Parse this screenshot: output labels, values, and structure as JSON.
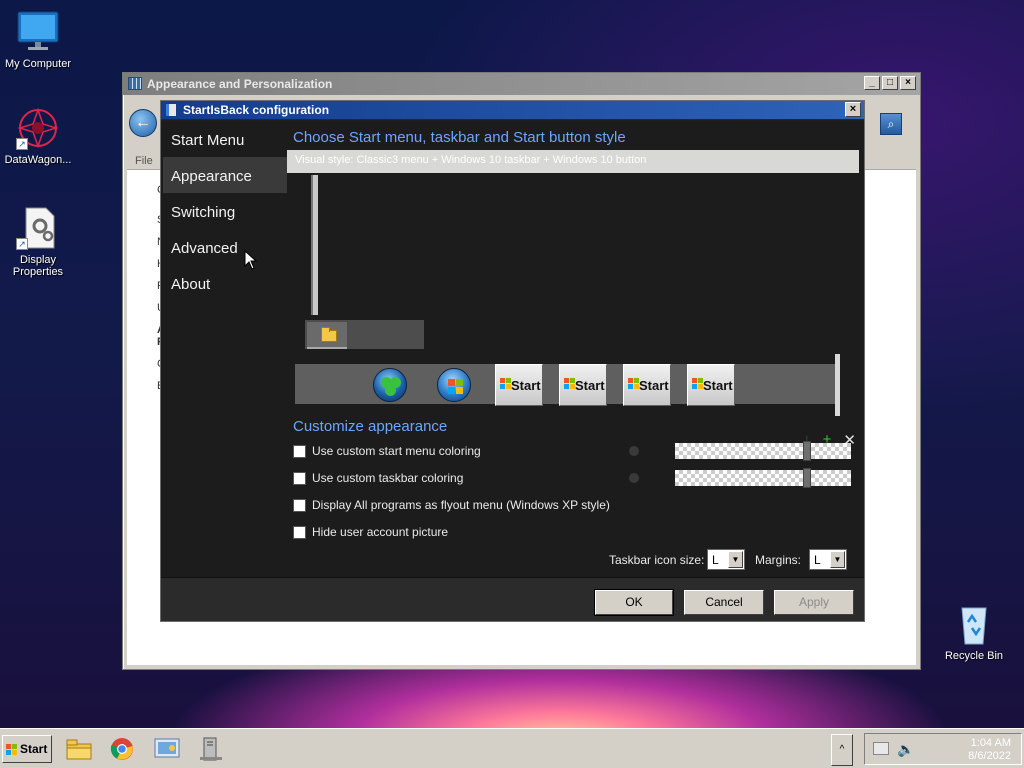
{
  "desktop": {
    "icons": [
      {
        "label": "My Computer",
        "icon": "monitor-icon"
      },
      {
        "label": "DataWagon...",
        "icon": "datawagon-icon"
      },
      {
        "label": "Display Properties",
        "icon": "display-properties-icon"
      },
      {
        "label": "Recycle Bin",
        "icon": "recycle-bin-icon"
      }
    ]
  },
  "outer_window": {
    "title": "Appearance and Personalization",
    "menu_file": "File",
    "list_letters": [
      "C",
      "S",
      "N",
      "H",
      "P",
      "U",
      "A",
      "P",
      "C",
      "E"
    ]
  },
  "dialog": {
    "title": "StartIsBack configuration",
    "nav": [
      "Start Menu",
      "Appearance",
      "Switching",
      "Advanced",
      "About"
    ],
    "active_nav": "Appearance",
    "heading_style": "Choose Start menu, taskbar and Start button style",
    "visual_style": "Visual style:  Classic3 menu + Windows 10 taskbar + Windows 10 button",
    "start_samples": [
      "Start",
      "Start",
      "Start",
      "Start"
    ],
    "heading_customize": "Customize appearance",
    "options": [
      {
        "label": "Use custom start menu coloring",
        "checked": false
      },
      {
        "label": "Use custom taskbar coloring",
        "checked": false
      },
      {
        "label": "Display All programs as flyout menu (Windows XP style)",
        "checked": false
      },
      {
        "label": "Hide user account picture",
        "checked": false
      }
    ],
    "slider_levels": [
      0.75,
      0.75
    ],
    "taskbar_icon_size_label": "Taskbar icon size:",
    "taskbar_icon_size_value": "L",
    "margins_label": "Margins:",
    "margins_value": "L",
    "tool_icons": [
      "download-icon",
      "plus-icon",
      "close-icon"
    ],
    "buttons": {
      "ok": "OK",
      "cancel": "Cancel",
      "apply": "Apply"
    }
  },
  "taskbar": {
    "start_label": "Start",
    "apps": [
      "file-explorer-icon",
      "chrome-icon",
      "control-panel-icon",
      "server-icon"
    ],
    "tray_chevron": "^",
    "time": "1:04 AM",
    "date": "8/6/2022"
  }
}
